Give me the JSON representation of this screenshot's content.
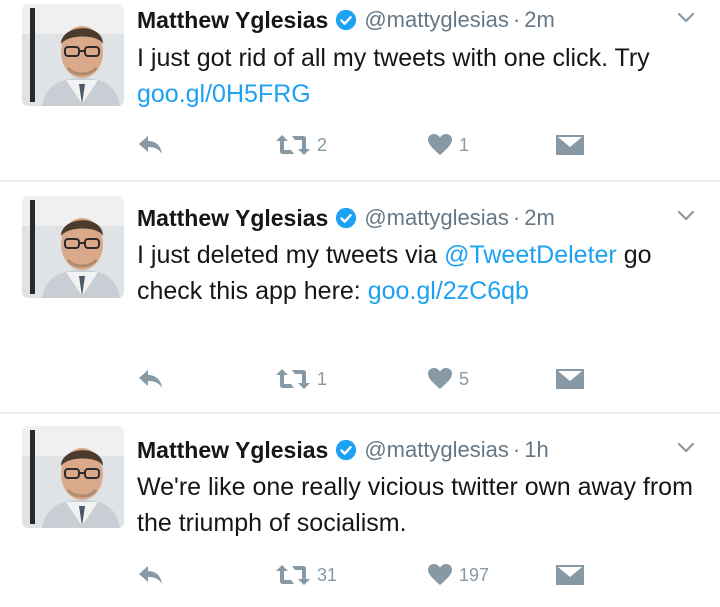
{
  "colors": {
    "link": "#1da1f2",
    "icon": "#8899a6",
    "verified_badge": "#1da1f2",
    "divider": "#e6ecf0"
  },
  "tweets": [
    {
      "name": "Matthew Yglesias",
      "handle": "@mattyglesias",
      "separator": "·",
      "time": "2m",
      "text": [
        {
          "t": "I just got rid of all my tweets with one click. Try ",
          "link": false
        },
        {
          "t": "goo.gl/0H5FRG",
          "link": true
        }
      ],
      "retweets": "2",
      "likes": "1"
    },
    {
      "name": "Matthew Yglesias",
      "handle": "@mattyglesias",
      "separator": "·",
      "time": "2m",
      "text": [
        {
          "t": "I just deleted my tweets via ",
          "link": false
        },
        {
          "t": "@TweetDeleter",
          "link": true
        },
        {
          "t": " go check this app here: ",
          "link": false
        },
        {
          "t": "goo.gl/2zC6qb",
          "link": true
        }
      ],
      "retweets": "1",
      "likes": "5"
    },
    {
      "name": "Matthew Yglesias",
      "handle": "@mattyglesias",
      "separator": "·",
      "time": "1h",
      "text": [
        {
          "t": "We're like one really vicious twitter own away from the triumph of socialism.",
          "link": false
        }
      ],
      "retweets": "31",
      "likes": "197"
    }
  ],
  "icons": {
    "verified": "verified-badge-icon",
    "caret": "chevron-down-icon",
    "reply": "reply-arrow-icon",
    "retweet": "retweet-icon",
    "like": "heart-icon",
    "dm": "envelope-icon"
  }
}
